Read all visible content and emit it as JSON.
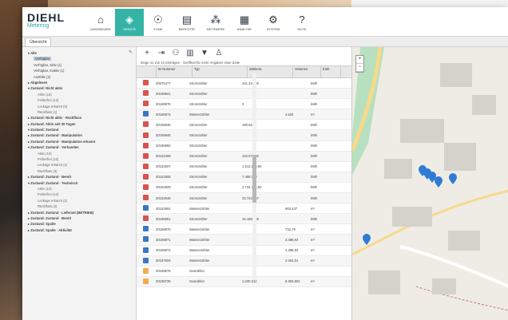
{
  "brand": {
    "name": "DIEHL",
    "sub": "Metering"
  },
  "nav": [
    {
      "name": "nav-dashboard",
      "icon": "⌂",
      "label": "DASHBOARD",
      "active": false
    },
    {
      "name": "nav-geraete",
      "icon": "◈",
      "label": "GERÄTE",
      "active": true
    },
    {
      "name": "nav-funk",
      "icon": "☉",
      "label": "FUNK",
      "active": false
    },
    {
      "name": "nav-berichte",
      "icon": "▤",
      "label": "BERICHTE",
      "active": false
    },
    {
      "name": "nav-netzwerk",
      "icon": "⁂",
      "label": "NETZWERK",
      "active": false
    },
    {
      "name": "nav-analyse",
      "icon": "▦",
      "label": "ANALYSE",
      "active": false
    },
    {
      "name": "nav-system",
      "icon": "⚙",
      "label": "SYSTEM",
      "active": false
    },
    {
      "name": "nav-hilfe",
      "icon": "?",
      "label": "HILFE",
      "active": false
    }
  ],
  "tab_label": "Übersicht",
  "tree": [
    {
      "lv": 0,
      "text": "▾ Alle",
      "sel": false
    },
    {
      "lv": 1,
      "text": "Verfügbar",
      "sel": true
    },
    {
      "lv": 1,
      "text": "Verfügbar, aktiv (1)",
      "sel": false
    },
    {
      "lv": 1,
      "text": "Verfügbar, inaktiv (1)",
      "sel": false
    },
    {
      "lv": 1,
      "text": "Ausfälle (2)",
      "sel": false
    },
    {
      "lv": 0,
      "text": "▸ Abgelesen",
      "sel": false
    },
    {
      "lv": 0,
      "text": "▾ Zustand: Nicht aktiv",
      "sel": false
    },
    {
      "lv": 2,
      "text": "Aktiv (15)",
      "sel": false
    },
    {
      "lv": 2,
      "text": "Fehlerfrei (12)",
      "sel": false
    },
    {
      "lv": 2,
      "text": "Leckage erkannt (3)",
      "sel": false
    },
    {
      "lv": 2,
      "text": "Rückfluss (1)",
      "sel": false
    },
    {
      "lv": 0,
      "text": "▸ Zustand: Nicht aktiv · Rückfluss",
      "sel": false
    },
    {
      "lv": 0,
      "text": "▸ Zustand: Aktiv seit 30 Tagen",
      "sel": false
    },
    {
      "lv": 0,
      "text": "▾ Zustand: Zustand",
      "sel": false
    },
    {
      "lv": 0,
      "text": "▸ Zustand: Zustand · Manipulation",
      "sel": false
    },
    {
      "lv": 0,
      "text": "▸ Zustand: Zustand · Manipulation erkannt",
      "sel": false
    },
    {
      "lv": 0,
      "text": "▾ Zustand: Zustand · Vorhanden",
      "sel": false
    },
    {
      "lv": 2,
      "text": "Aktiv (10)",
      "sel": false
    },
    {
      "lv": 2,
      "text": "Fehlerfrei (10)",
      "sel": false
    },
    {
      "lv": 2,
      "text": "Leckage erkannt (1)",
      "sel": false
    },
    {
      "lv": 2,
      "text": "Rückfluss (3)",
      "sel": false
    },
    {
      "lv": 0,
      "text": "▸ Zustand: Zustand · Bereit",
      "sel": false
    },
    {
      "lv": 0,
      "text": "▾ Zustand: Zustand · Technisch",
      "sel": false
    },
    {
      "lv": 2,
      "text": "Aktiv (13)",
      "sel": false
    },
    {
      "lv": 2,
      "text": "Fehlerfrei (13)",
      "sel": false
    },
    {
      "lv": 2,
      "text": "Leckage erkannt (2)",
      "sel": false
    },
    {
      "lv": 2,
      "text": "Rückfluss (2)",
      "sel": false
    },
    {
      "lv": 0,
      "text": "▸ Zustand: Zustand · Lieferant (BETRIEB)",
      "sel": false
    },
    {
      "lv": 0,
      "text": "▸ Zustand: Zustand · Bereit",
      "sel": false
    },
    {
      "lv": 0,
      "text": "▸ Zustand: Spalte",
      "sel": false
    },
    {
      "lv": 0,
      "text": "▸ Zustand: Spalte · Aktivität",
      "sel": false
    }
  ],
  "toolbar": [
    {
      "name": "add-icon",
      "icon": "+"
    },
    {
      "name": "import-icon",
      "icon": "⇥"
    },
    {
      "name": "group-icon",
      "icon": "⚇"
    },
    {
      "name": "chart-icon",
      "icon": "▥"
    },
    {
      "name": "filter-icon",
      "icon": "▼"
    },
    {
      "name": "user-icon",
      "icon": "♙"
    }
  ],
  "info_text": "Zeige 41 von 41 Einträgen · Geöffnet für mehr Angaben einer Zeile",
  "columns": [
    "",
    "ID Nummer",
    "Typ",
    "Zählerst.",
    "Volumen",
    "Einh."
  ],
  "rows": [
    {
      "color": "#d9534f",
      "id": "30675477",
      "type": "Stromzähler",
      "val": "101.346,00",
      "v2": "",
      "u": "kWh"
    },
    {
      "color": "#d9534f",
      "id": "30196941",
      "type": "Stromzähler",
      "val": "",
      "v2": "",
      "u": "kWh"
    },
    {
      "color": "#d9534f",
      "id": "30196976",
      "type": "Stromzähler",
      "val": "0",
      "v2": "",
      "u": "kWh"
    },
    {
      "color": "#3a78c2",
      "id": "30196973",
      "type": "Wasserzähler",
      "val": "",
      "v2": "4.524",
      "u": "m³"
    },
    {
      "color": "#d9534f",
      "id": "30196946",
      "type": "Stromzähler",
      "val": "180.556",
      "v2": "",
      "u": "kWh"
    },
    {
      "color": "#d9534f",
      "id": "30196948",
      "type": "Stromzähler",
      "val": "",
      "v2": "",
      "u": "kWh"
    },
    {
      "color": "#d9534f",
      "id": "30196950",
      "type": "Stromzähler",
      "val": "",
      "v2": "",
      "u": "kWh"
    },
    {
      "color": "#d9534f",
      "id": "30152499",
      "type": "Stromzähler",
      "val": "102.875,30",
      "v2": "",
      "u": "kWh"
    },
    {
      "color": "#d9534f",
      "id": "30152507",
      "type": "Stromzähler",
      "val": "1.512.155,90",
      "v2": "",
      "u": "kWh"
    },
    {
      "color": "#d9534f",
      "id": "30152508",
      "type": "Stromzähler",
      "val": "7.459.760",
      "v2": "",
      "u": "kWh"
    },
    {
      "color": "#d9534f",
      "id": "30152509",
      "type": "Stromzähler",
      "val": "2.734.772,50",
      "v2": "",
      "u": "kWh"
    },
    {
      "color": "#d9534f",
      "id": "30152546",
      "type": "Stromzähler",
      "val": "33.734.787",
      "v2": "",
      "u": "kWh"
    },
    {
      "color": "#3a78c2",
      "id": "30153591",
      "type": "Wasserzähler",
      "val": "",
      "v2": "963,447",
      "u": "m³"
    },
    {
      "color": "#d9534f",
      "id": "30196951",
      "type": "Stromzähler",
      "val": "16.188.886",
      "v2": "",
      "u": "kWh"
    },
    {
      "color": "#3a78c2",
      "id": "30198870",
      "type": "Wasserzähler",
      "val": "",
      "v2": "732,79",
      "u": "m³"
    },
    {
      "color": "#3a78c2",
      "id": "30198871",
      "type": "Wasserzähler",
      "val": "",
      "v2": "3.488,93",
      "u": "m³"
    },
    {
      "color": "#3a78c2",
      "id": "30198872",
      "type": "Wasserzähler",
      "val": "",
      "v2": "4.488,93",
      "u": "m³"
    },
    {
      "color": "#3a78c2",
      "id": "30197509",
      "type": "Wasserzähler",
      "val": "",
      "v2": "2.264,01",
      "u": "m³"
    },
    {
      "color": "#f0ad4e",
      "id": "30198676",
      "type": "Gaszähler",
      "val": "",
      "v2": "",
      "u": ""
    },
    {
      "color": "#f0ad4e",
      "id": "30198735",
      "type": "Gaszähler",
      "val": "1.030.312",
      "v2": "8.393,802",
      "u": "m³"
    }
  ],
  "map": {
    "zoom_in": "+",
    "zoom_out": "−",
    "pin_color": "#2f7bd4",
    "road_color": "#f7d98a",
    "green_color": "#b7e0c0"
  }
}
